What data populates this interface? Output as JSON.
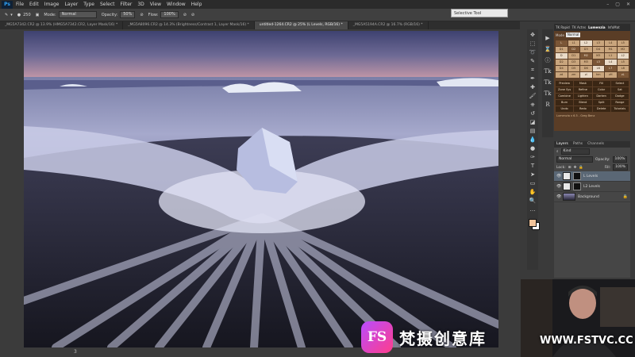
{
  "menubar": {
    "logo": "Ps",
    "items": [
      "File",
      "Edit",
      "Image",
      "Layer",
      "Type",
      "Select",
      "Filter",
      "3D",
      "View",
      "Window",
      "Help"
    ]
  },
  "options": {
    "size": "250",
    "mode_label": "Mode:",
    "mode_value": "Normal",
    "opacity_label": "Opacity:",
    "opacity_value": "50%",
    "flow_label": "Flow:",
    "flow_value": "100%"
  },
  "selective_tool": {
    "label": "Selective Tool"
  },
  "tabs": [
    {
      "label": "_MG5A7342.CR2 @ 13.9% (HMG5A7342.CR2, Layer Mask/16) *",
      "active": false
    },
    {
      "label": "_MG5A8096.CR2 @ 14.3% (Brightness/Contrast 1, Layer Mask/16) *",
      "active": false
    },
    {
      "label": "untitled-1264.CR2 @ 25% (L Levels, RGB/16) *",
      "active": true
    },
    {
      "label": "_MG5A5194A.CR2 @ 16.7% (RGB/16) *",
      "active": false
    }
  ],
  "ruler_number": "3",
  "lumenzia": {
    "tabs": [
      "TK Rapid",
      "TK Actns",
      "Lumenzia",
      "InfoMat"
    ],
    "active_tab": "Lumenzia",
    "mode_label": "Mode",
    "mode_value": "Normal",
    "grid": [
      "L",
      "L1",
      "L2",
      "L3",
      "L4",
      "L5",
      "D1",
      "D2",
      "D3",
      "D4",
      "M1",
      "M2",
      "D",
      "D1",
      "M2",
      "M3",
      "L1",
      "L2",
      "D2",
      "D3",
      "M3",
      "L3",
      "L4",
      "L5",
      "D4",
      "D5",
      "D6",
      "L6",
      "L7",
      "L8",
      "zd",
      "zm",
      "zl",
      "hm",
      "zH",
      "zL"
    ],
    "buttons": [
      "Preview",
      "Mask",
      "Fill",
      "Select",
      "Zone Sys",
      "Refine",
      "Color",
      "Sat",
      "Combine",
      "Lighten",
      "Darken",
      "Dodge",
      "Burn",
      "Blend",
      "Split",
      "Range",
      "Undo",
      "Redo",
      "Delete",
      "Tutorials"
    ],
    "footer": "Lumenzia v 6.5 - Greg Benz"
  },
  "layers": {
    "tabs": [
      "Layers",
      "Paths",
      "Channels"
    ],
    "active_tab": "Layers",
    "kind": "Kind",
    "blend": "Normal",
    "opacity_label": "Opacity:",
    "opacity_value": "100%",
    "lock_label": "Lock:",
    "fill_label": "Fill:",
    "fill_value": "100%",
    "items": [
      {
        "name": "L Levels",
        "selected": true
      },
      {
        "name": "L2 Levels",
        "selected": false
      },
      {
        "name": "Background",
        "selected": false
      }
    ]
  },
  "watermark": {
    "logo": "FS",
    "text_cn": "梵摄创意库",
    "url": "WWW.FSTVC.CC"
  },
  "icons": [
    "brush-icon",
    "move-icon",
    "marquee-icon",
    "lasso-icon",
    "quick-select-icon",
    "crop-icon",
    "eyedropper-icon",
    "healing-icon",
    "clone-icon",
    "history-brush-icon",
    "eraser-icon",
    "gradient-icon",
    "blur-icon",
    "dodge-icon",
    "pen-icon",
    "type-icon",
    "path-select-icon",
    "shape-icon",
    "hand-icon",
    "zoom-icon"
  ]
}
